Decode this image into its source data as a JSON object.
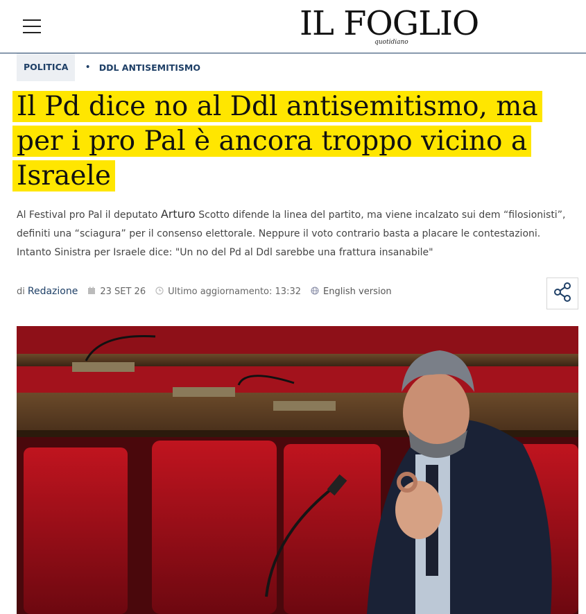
{
  "header": {
    "logo": "IL FOGLIO",
    "logo_sub": "quotidiano",
    "menu_icon": "hamburger-menu-icon"
  },
  "breadcrumb": {
    "category": "POLITICA",
    "tag": "DDL ANTISEMITISMO"
  },
  "article": {
    "title_lines": [
      "Il Pd dice no al Ddl antisemitismo, ma",
      "per i pro Pal è ancora troppo vicino a",
      "Israele"
    ],
    "summary": {
      "part1": "Al Festival pro Pal il deputato ",
      "person": "Arturo",
      "part2": " Scotto  difende la linea del partito, ma viene incalzato sui dem “filosionisti”, definiti una “sciagura” per il consenso elettorale. Neppure il voto contrario basta a placare le contestazioni. Intanto Sinistra per Israele dice: \"Un no del Pd al Ddl sarebbe una frattura insanabile\""
    },
    "meta": {
      "by": "di",
      "author": "Redazione",
      "date": "23 SET 26",
      "updated": "Ultimo aggiornamento: 13:32",
      "lang": "English version"
    }
  },
  "colors": {
    "highlight": "#ffe600",
    "accent": "#1e3f66",
    "seat_red": "#a8111b"
  }
}
